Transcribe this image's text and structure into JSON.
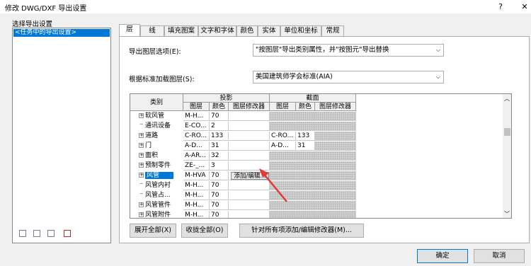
{
  "window": {
    "title": "修改 DWG/DXF 导出设置",
    "help": "?",
    "close": "✕"
  },
  "left": {
    "group_label": "选择导出设置",
    "selected_item": "<任务中的导出设置>",
    "icons": [
      "new-setting-icon",
      "duplicate-icon",
      "rename-icon",
      "delete-icon"
    ]
  },
  "tabs": [
    "层",
    "线",
    "填充图案",
    "文字和字体",
    "颜色",
    "实体",
    "单位和坐标",
    "常规"
  ],
  "active_tab": "层",
  "options": {
    "export_label": "导出图层选项(E):",
    "export_value": "\"按图层\"导出类别属性，并\"按图元\"导出替换",
    "standard_label": "根据标准加载图层(S):",
    "standard_value": "美国建筑师学会标准(AIA)"
  },
  "grid": {
    "headers": {
      "category": "类别",
      "projection": "投影",
      "cut": "截面",
      "layer": "图层",
      "color": "颜色",
      "modifier": "图层修改器"
    },
    "rows": [
      {
        "name": "软风管",
        "exp": true,
        "layer": "M-H...",
        "color": "70",
        "clayer": "",
        "ccolor": ""
      },
      {
        "name": "通讯设备",
        "exp": false,
        "layer": "E-CO...",
        "color": "2",
        "clayer": "",
        "ccolor": ""
      },
      {
        "name": "道路",
        "exp": true,
        "layer": "C-RO...",
        "color": "133",
        "clayer": "C-RO...",
        "ccolor": "133"
      },
      {
        "name": "门",
        "exp": true,
        "layer": "A-D...",
        "color": "31",
        "clayer": "A-D...",
        "ccolor": "31"
      },
      {
        "name": "面积",
        "exp": true,
        "layer": "A-AR...",
        "color": "32",
        "clayer": "",
        "ccolor": ""
      },
      {
        "name": "预制零件",
        "exp": true,
        "layer": "ZE-_...",
        "color": "3",
        "clayer": "",
        "ccolor": ""
      },
      {
        "name": "风管",
        "exp": true,
        "layer": "M-HVA",
        "color": "70",
        "clayer": "",
        "ccolor": "",
        "selected": true,
        "modifier_button": "添加/编辑..."
      },
      {
        "name": "风管内衬",
        "exp": false,
        "layer": "M-H...",
        "color": "70",
        "clayer": "",
        "ccolor": ""
      },
      {
        "name": "风管占...",
        "exp": false,
        "layer": "M-H...",
        "color": "70",
        "clayer": "",
        "ccolor": ""
      },
      {
        "name": "风管管件",
        "exp": true,
        "layer": "M-H...",
        "color": "70",
        "clayer": "",
        "ccolor": ""
      },
      {
        "name": "风管附件",
        "exp": true,
        "layer": "M-H...",
        "color": "70",
        "clayer": "",
        "ccolor": ""
      }
    ]
  },
  "buttons": {
    "expand_all": "展开全部(X)",
    "collapse_all": "收拢全部(O)",
    "add_edit_all": "针对所有项添加/编辑修改器(M)...",
    "ok": "确定",
    "cancel": "取消"
  },
  "colors": {
    "selection": "#0078d7",
    "annotation_arrow": "#e03a3a"
  }
}
